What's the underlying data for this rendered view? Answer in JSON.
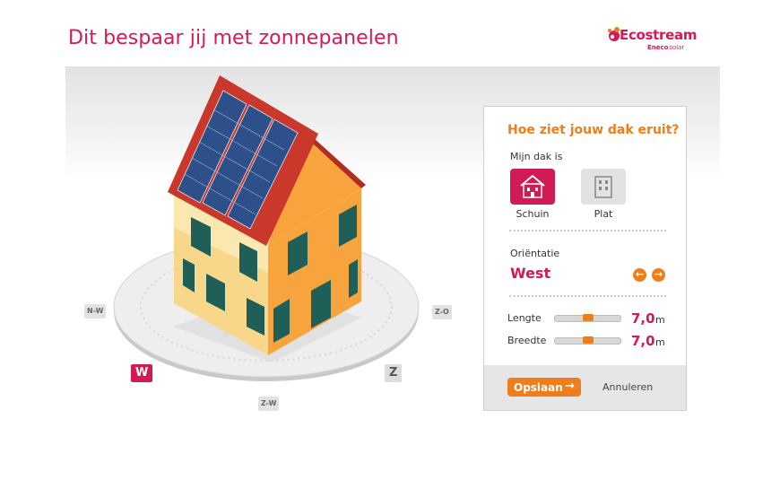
{
  "page": {
    "title": "Dit bespaar jij met zonnepanelen"
  },
  "logo": {
    "name": "Ecostream",
    "sub_brand": "Eneco",
    "sub_suffix": "solar"
  },
  "compass": {
    "nw": "N-W",
    "zo": "Z-O",
    "w": "W",
    "z": "Z",
    "zw": "Z-W",
    "selected": "W"
  },
  "panel": {
    "heading": "Hoe ziet jouw dak eruit?",
    "roof_label": "Mijn dak is",
    "roof_options": [
      {
        "label": "Schuin",
        "selected": true,
        "icon": "pitched-roof-house-icon"
      },
      {
        "label": "Plat",
        "selected": false,
        "icon": "flat-roof-building-icon"
      }
    ],
    "orientation_label": "Oriëntatie",
    "orientation_value": "West",
    "length_label": "Lengte",
    "length_value": "7,0",
    "length_unit": "m",
    "length_fraction": 0.5,
    "width_label": "Breedte",
    "width_value": "7,0",
    "width_unit": "m",
    "width_fraction": 0.5,
    "save_label": "Opslaan",
    "cancel_label": "Annuleren"
  },
  "colors": {
    "brand": "#d21b55",
    "accent": "#ef7d1a"
  }
}
